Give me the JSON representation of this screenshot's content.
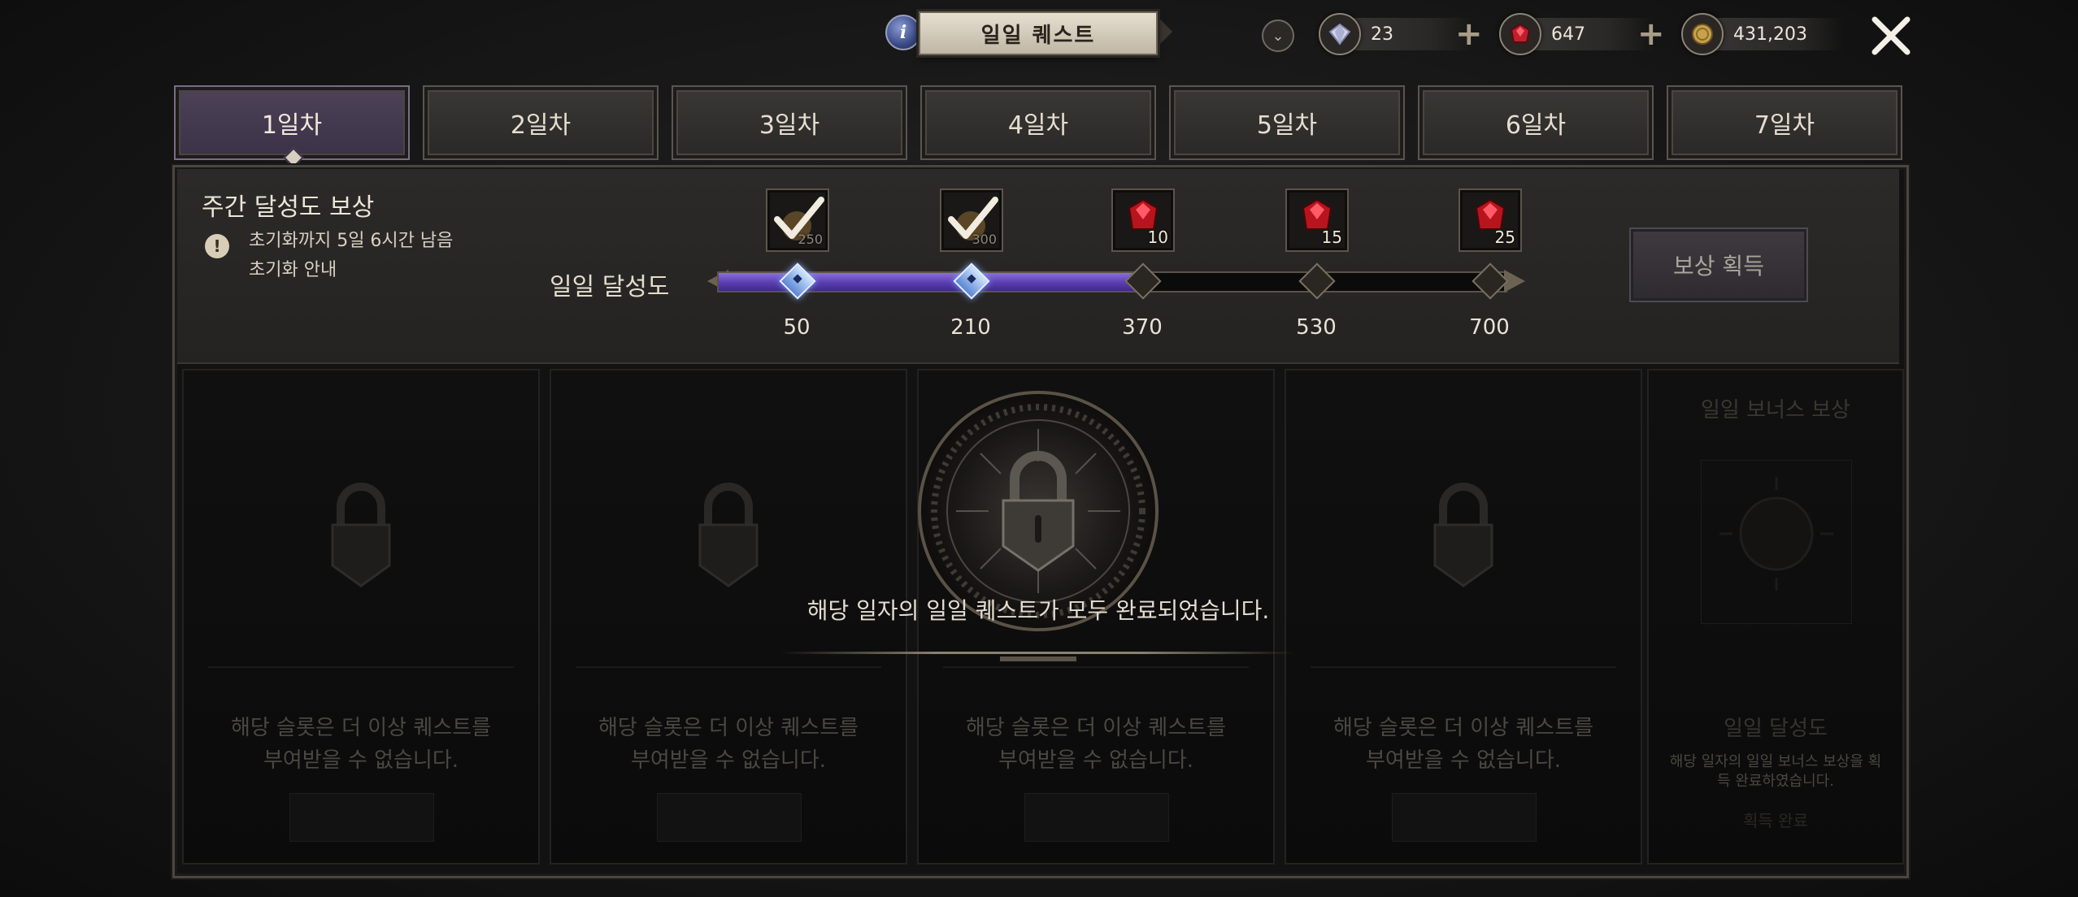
{
  "header": {
    "title": "일일 퀘스트",
    "info_icon": "i",
    "dropdown_icon": "chevron-down-icon",
    "close_icon": "close-icon",
    "currencies": [
      {
        "name": "diamond",
        "icon": "diamond-icon",
        "value": "23",
        "plus": "+"
      },
      {
        "name": "ruby",
        "icon": "ruby-icon",
        "value": "647",
        "plus": "+"
      },
      {
        "name": "gold",
        "icon": "gold-coin-icon",
        "value": "431,203"
      }
    ]
  },
  "tabs": [
    {
      "label": "1일차",
      "active": true
    },
    {
      "label": "2일차"
    },
    {
      "label": "3일차"
    },
    {
      "label": "4일차"
    },
    {
      "label": "5일차"
    },
    {
      "label": "6일차"
    },
    {
      "label": "7일차"
    }
  ],
  "weekly": {
    "title": "주간 달성도 보상",
    "warning_icon": "!",
    "reset_text": "초기화까지 5일 6시간 남음",
    "reset_guide": "초기화 안내",
    "claim_label": "보상 획득"
  },
  "daily_progress": {
    "label": "일일 달성도",
    "current": 370,
    "max": 700,
    "milestones": [
      {
        "value": "50",
        "reward_icon": "claimed-check-icon",
        "qty": "250",
        "claimed": true
      },
      {
        "value": "210",
        "reward_icon": "claimed-check-icon",
        "qty": "300",
        "claimed": true
      },
      {
        "value": "370",
        "reward_icon": "ruby-icon",
        "qty": "10",
        "claimed": false
      },
      {
        "value": "530",
        "reward_icon": "ruby-icon",
        "qty": "15",
        "claimed": false
      },
      {
        "value": "700",
        "reward_icon": "ruby-icon",
        "qty": "25",
        "claimed": false
      }
    ]
  },
  "cards": {
    "slot_message_line1": "해당 슬롯은 더 이상 퀘스트를",
    "slot_message_line2": "부여받을 수 없습니다.",
    "bonus": {
      "title": "일일 보너스 보상",
      "subtitle": "일일 달성도",
      "message": "해당 일자의 일일 보너스 보상을 획득 완료하였습니다.",
      "done": "획득 완료"
    }
  },
  "completion_message": "해당 일자의 일일 퀘스트가 모두 완료되었습니다.",
  "colors": {
    "accent_purple": "#5a3eb0",
    "marker_done": "#7aa2ff",
    "ruby": "#c0202a"
  }
}
